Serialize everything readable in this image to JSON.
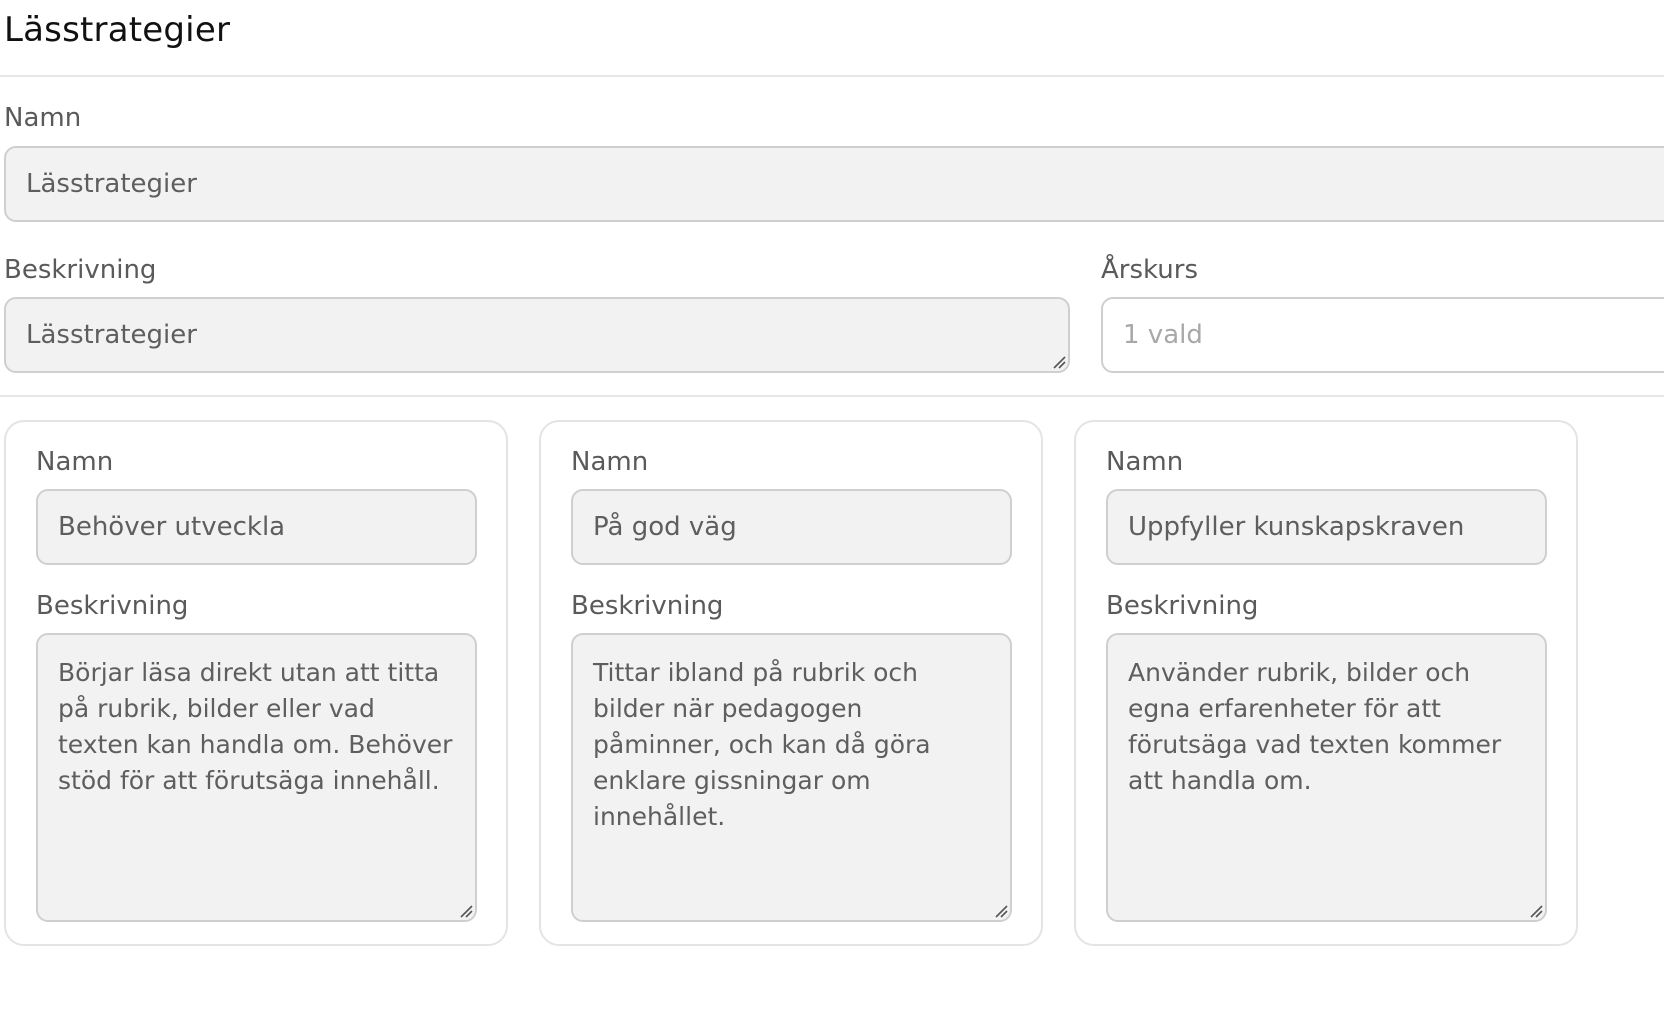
{
  "page": {
    "title": "Lässtrategier"
  },
  "form": {
    "name_label": "Namn",
    "name_value": "Lässtrategier",
    "description_label": "Beskrivning",
    "description_value": "Lässtrategier",
    "grade_label": "Årskurs",
    "grade_value": "1 vald"
  },
  "levels": [
    {
      "name_label": "Namn",
      "name_value": "Behöver utveckla",
      "description_label": "Beskrivning",
      "description_value": "Börjar läsa direkt utan att titta på rubrik, bilder eller vad texten kan handla om. Behöver stöd för att förutsäga innehåll."
    },
    {
      "name_label": "Namn",
      "name_value": "På god väg",
      "description_label": "Beskrivning",
      "description_value": "Tittar ibland på rubrik och bilder när pedagogen påminner, och kan då göra enklare gissningar om innehållet."
    },
    {
      "name_label": "Namn",
      "name_value": "Uppfyller kunskapskraven",
      "description_label": "Beskrivning",
      "description_value": "Använder rubrik, bilder och egna erfarenheter för att förutsäga vad texten kommer att handla om."
    }
  ],
  "colors": {
    "field_bg": "#f2f2f2",
    "field_border": "#cfcfcf",
    "label": "#5a5a5a",
    "divider": "#e6e6e6"
  }
}
